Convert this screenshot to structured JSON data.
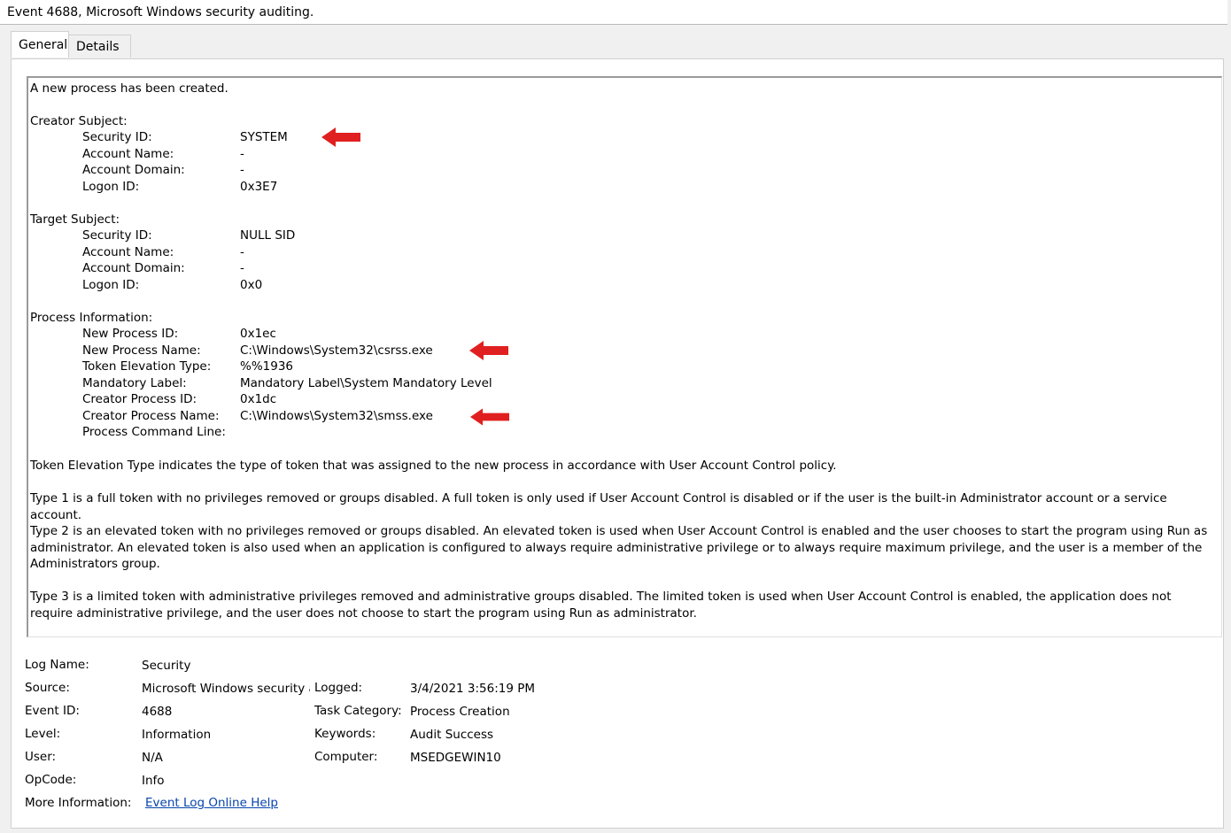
{
  "window": {
    "title": "Event 4688, Microsoft Windows security auditing."
  },
  "tabs": [
    {
      "label": "General"
    },
    {
      "label": "Details"
    }
  ],
  "description": {
    "intro": "A new process has been created.",
    "creator_subject": {
      "heading": "Creator Subject:",
      "fields": [
        {
          "label": "Security ID:",
          "value": "SYSTEM"
        },
        {
          "label": "Account Name:",
          "value": "-"
        },
        {
          "label": "Account Domain:",
          "value": "-"
        },
        {
          "label": "Logon ID:",
          "value": "0x3E7"
        }
      ]
    },
    "target_subject": {
      "heading": "Target Subject:",
      "fields": [
        {
          "label": "Security ID:",
          "value": "NULL SID"
        },
        {
          "label": "Account Name:",
          "value": "-"
        },
        {
          "label": "Account Domain:",
          "value": "-"
        },
        {
          "label": "Logon ID:",
          "value": "0x0"
        }
      ]
    },
    "process_information": {
      "heading": "Process Information:",
      "fields": [
        {
          "label": "New Process ID:",
          "value": "0x1ec"
        },
        {
          "label": "New Process Name:",
          "value": "C:\\Windows\\System32\\csrss.exe"
        },
        {
          "label": "Token Elevation Type:",
          "value": "%%1936"
        },
        {
          "label": "Mandatory Label:",
          "value": "Mandatory Label\\System Mandatory Level"
        },
        {
          "label": "Creator Process ID:",
          "value": "0x1dc"
        },
        {
          "label": "Creator Process Name:",
          "value": "C:\\Windows\\System32\\smss.exe"
        },
        {
          "label": "Process Command Line:",
          "value": ""
        }
      ]
    },
    "paragraphs": [
      "Token Elevation Type indicates the type of token that was assigned to the new process in accordance with User Account Control policy.",
      "Type 1 is a full token with no privileges removed or groups disabled.  A full token is only used if User Account Control is disabled or if the user is the built-in Administrator account or a service account.",
      "Type 2 is an elevated token with no privileges removed or groups disabled.  An elevated token is used when User Account Control is enabled and the user chooses to start the program using Run as administrator.  An elevated token is also used when an application is configured to always require administrative privilege or to always require maximum privilege, and the user is a member of the Administrators group.",
      "Type 3 is a limited token with administrative privileges removed and administrative groups disabled.  The limited token is used when User Account Control is enabled, the application does not require administrative privilege, and the user does not choose to start the program using Run as administrator."
    ]
  },
  "details": {
    "log_name": {
      "label": "Log Name:",
      "value": "Security"
    },
    "source": {
      "label": "Source:",
      "value": "Microsoft Windows security a"
    },
    "event_id": {
      "label": "Event ID:",
      "value": "4688"
    },
    "level": {
      "label": "Level:",
      "value": "Information"
    },
    "user": {
      "label": "User:",
      "value": "N/A"
    },
    "opcode": {
      "label": "OpCode:",
      "value": "Info"
    },
    "more_info": {
      "label": "More Information:",
      "value": "Event Log Online Help"
    },
    "logged": {
      "label": "Logged:",
      "value": "3/4/2021 3:56:19 PM"
    },
    "task_category": {
      "label": "Task Category:",
      "value": "Process Creation"
    },
    "keywords": {
      "label": "Keywords:",
      "value": "Audit Success"
    },
    "computer": {
      "label": "Computer:",
      "value": "MSEDGEWIN10"
    }
  },
  "colors": {
    "arrow": "#e02020",
    "link": "#0645ad"
  }
}
